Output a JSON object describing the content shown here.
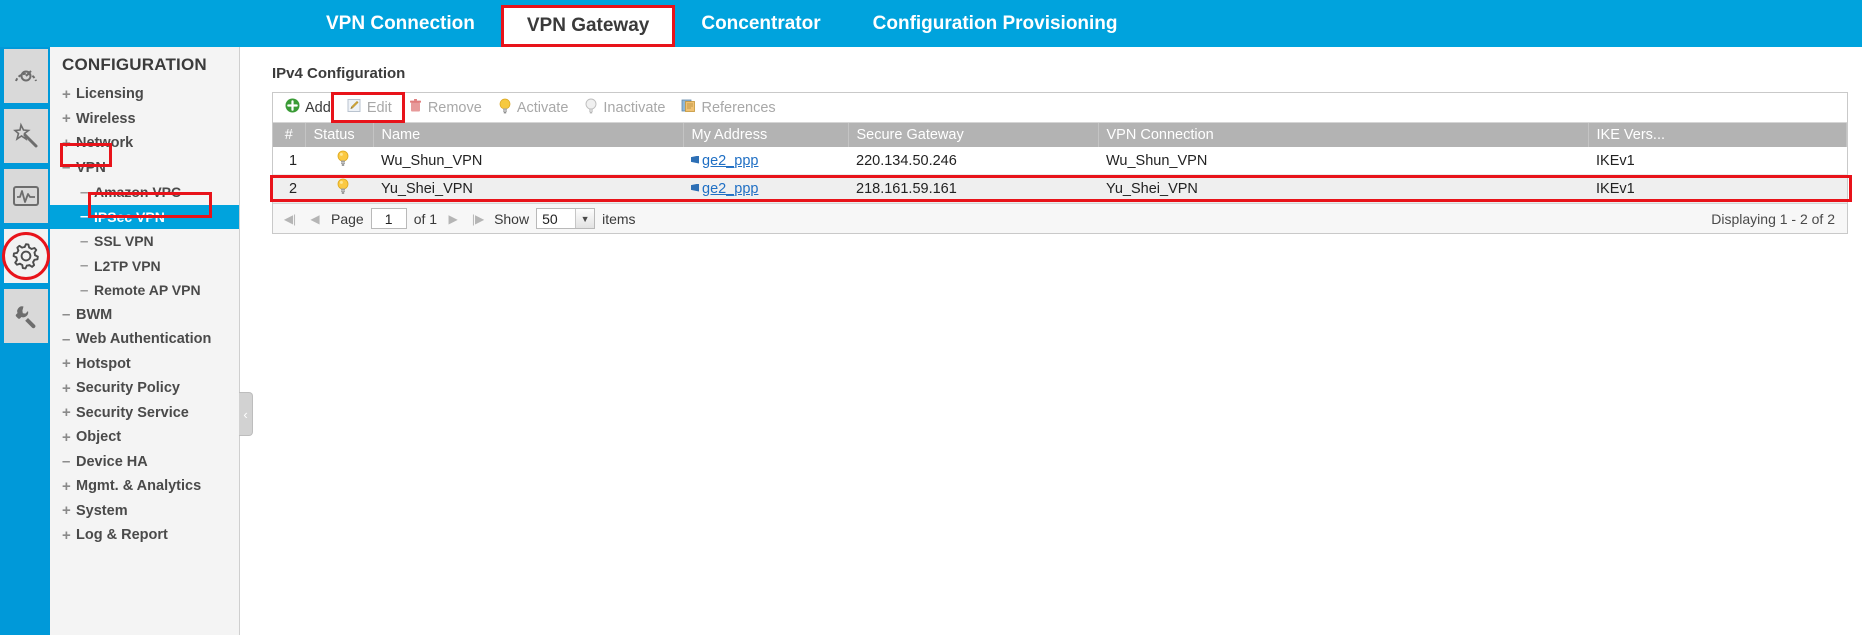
{
  "topbar": {
    "tabs": [
      {
        "label": "VPN Connection",
        "active": false
      },
      {
        "label": "VPN Gateway",
        "active": true
      },
      {
        "label": "Concentrator",
        "active": false
      },
      {
        "label": "Configuration Provisioning",
        "active": false
      }
    ]
  },
  "rail": {
    "items": [
      {
        "icon": "dashboard-icon",
        "selected": false
      },
      {
        "icon": "easy-mode-wand-icon",
        "selected": false
      },
      {
        "icon": "monitor-pulse-icon",
        "selected": false
      },
      {
        "icon": "gear-configuration-icon",
        "selected": true
      },
      {
        "icon": "maintenance-wrench-icon",
        "selected": false
      }
    ]
  },
  "sidebar": {
    "title": "CONFIGURATION",
    "items": [
      {
        "label": "Licensing",
        "toggle": "+",
        "level": 1,
        "active": false
      },
      {
        "label": "Wireless",
        "toggle": "+",
        "level": 1,
        "active": false
      },
      {
        "label": "Network",
        "toggle": "+",
        "level": 1,
        "active": false
      },
      {
        "label": "VPN",
        "toggle": "–",
        "level": 1,
        "active": false
      },
      {
        "label": "Amazon VPC",
        "toggle": "–",
        "level": 2,
        "active": false
      },
      {
        "label": "IPSec VPN",
        "toggle": "–",
        "level": 2,
        "active": true
      },
      {
        "label": "SSL VPN",
        "toggle": "–",
        "level": 2,
        "active": false
      },
      {
        "label": "L2TP VPN",
        "toggle": "–",
        "level": 2,
        "active": false
      },
      {
        "label": "Remote AP VPN",
        "toggle": "–",
        "level": 2,
        "active": false
      },
      {
        "label": "BWM",
        "toggle": "–",
        "level": 1,
        "active": false
      },
      {
        "label": "Web Authentication",
        "toggle": "–",
        "level": 1,
        "active": false
      },
      {
        "label": "Hotspot",
        "toggle": "+",
        "level": 1,
        "active": false
      },
      {
        "label": "Security Policy",
        "toggle": "+",
        "level": 1,
        "active": false
      },
      {
        "label": "Security Service",
        "toggle": "+",
        "level": 1,
        "active": false
      },
      {
        "label": "Object",
        "toggle": "+",
        "level": 1,
        "active": false
      },
      {
        "label": "Device HA",
        "toggle": "–",
        "level": 1,
        "active": false
      },
      {
        "label": "Mgmt. & Analytics",
        "toggle": "+",
        "level": 1,
        "active": false
      },
      {
        "label": "System",
        "toggle": "+",
        "level": 1,
        "active": false
      },
      {
        "label": "Log & Report",
        "toggle": "+",
        "level": 1,
        "active": false
      }
    ],
    "collapse_handle": "‹"
  },
  "main": {
    "panel_title": "IPv4 Configuration",
    "toolbar": [
      {
        "label": "Add",
        "icon": "add-plus-icon",
        "state": "enabled"
      },
      {
        "label": "Edit",
        "icon": "edit-pencil-icon",
        "state": "disabled"
      },
      {
        "label": "Remove",
        "icon": "trash-icon",
        "state": "disabled"
      },
      {
        "label": "Activate",
        "icon": "bulb-on-icon",
        "state": "disabled"
      },
      {
        "label": "Inactivate",
        "icon": "bulb-off-icon",
        "state": "disabled"
      },
      {
        "label": "References",
        "icon": "references-icon",
        "state": "disabled"
      }
    ],
    "table": {
      "columns": [
        "#",
        "Status",
        "Name",
        "My Address",
        "Secure Gateway",
        "VPN Connection",
        "IKE Vers..."
      ],
      "rows": [
        {
          "num": "1",
          "status": "active-bulb-icon",
          "name": "Wu_Shun_VPN",
          "my_address": "ge2_ppp",
          "secure_gateway": "220.134.50.246",
          "vpn_connection": "Wu_Shun_VPN",
          "ike_version": "IKEv1"
        },
        {
          "num": "2",
          "status": "active-bulb-icon",
          "name": "Yu_Shei_VPN",
          "my_address": "ge2_ppp",
          "secure_gateway": "218.161.59.161",
          "vpn_connection": "Yu_Shei_VPN",
          "ike_version": "IKEv1"
        }
      ]
    },
    "pager": {
      "first": "◀|",
      "prev": "◀",
      "page_label": "Page",
      "page_value": "1",
      "of_label": "of 1",
      "next": "▶",
      "last": "|▶",
      "show_label": "Show",
      "show_value": "50",
      "items_label": "items",
      "displaying": "Displaying 1 - 2 of 2"
    }
  },
  "colors": {
    "brand_blue": "#00a3dd",
    "highlight_red": "#e8131a",
    "header_gray": "#b3b3b3",
    "link_blue": "#1f6fc4"
  }
}
